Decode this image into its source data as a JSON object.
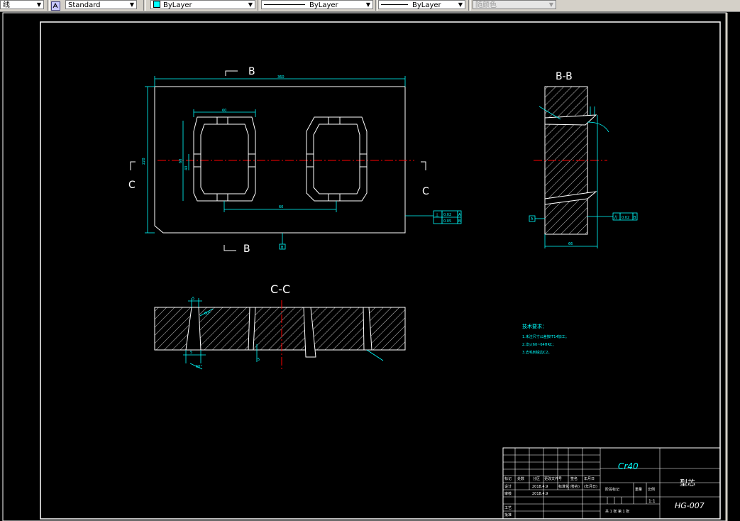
{
  "toolbar": {
    "layer_value": "线",
    "text_style": "Standard",
    "color": "ByLayer",
    "linetype": "ByLayer",
    "lineweight": "ByLayer",
    "plot_style": "随颜色"
  },
  "colors": {
    "cyan": "#00ffff",
    "white": "#ffffff",
    "red": "#ff0000",
    "background": "#000000"
  },
  "drawing": {
    "top_view": {
      "section_b_top": "B",
      "section_b_bottom": "B",
      "section_c_left": "C",
      "section_c_right": "C",
      "dim_width": "360",
      "dim_height": "220",
      "dim_window": "60",
      "dim_spacing": "60",
      "dim_inner_h": "60",
      "dim_small": "40",
      "tol_flat": "0.02",
      "tol_flat_ref": "A",
      "tol_perp": "0.05",
      "tol_perp_ref": "B",
      "datum": "B"
    },
    "section_bb": {
      "title": "B-B",
      "dim_width": "66",
      "tol_parallel": "0.02",
      "tol_ref": "B",
      "datum": "A"
    },
    "section_cc": {
      "title": "C-C"
    },
    "tech_notes": {
      "heading": "技术要求：",
      "lines": [
        "1.未注尺寸公差按IT14加工；",
        "2.淬火60~64HRC；",
        "3.去毛刺锐边C2。"
      ]
    },
    "title_block": {
      "material": "Cr40",
      "part_name": "型芯",
      "drawing_no": "HG-007",
      "scale": "1:1",
      "row_labels": [
        "标记",
        "处数",
        "分区",
        "更改文件号",
        "签名",
        "年月日"
      ],
      "design": "设计",
      "design_date": "2018.4.9",
      "standard": "标准化",
      "sign": "(签名)",
      "date": "(年月日)",
      "review": "审核",
      "review_date": "2018.4.9",
      "process": "工艺",
      "approve": "批准",
      "stage_mark": "阶段标记",
      "weight": "重量",
      "ratio": "比例",
      "sheet_info": "共 1 张  第 1 张"
    }
  }
}
